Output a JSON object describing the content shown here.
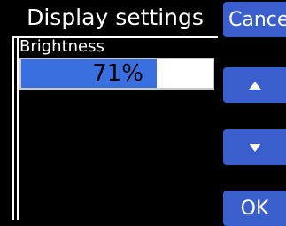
{
  "dialog": {
    "title": "Display settings"
  },
  "buttons": {
    "cancel_label": "Cancel",
    "up_icon": "up-arrow",
    "down_icon": "down-arrow",
    "ok_label": "OK"
  },
  "brightness": {
    "label": "Brightness",
    "value_text": "71%",
    "value": 0.71
  },
  "colors": {
    "background": "#000000",
    "button": "#3a5fcc",
    "bar_fill": "#3a6fe0",
    "bar_track": "#ffffff"
  }
}
